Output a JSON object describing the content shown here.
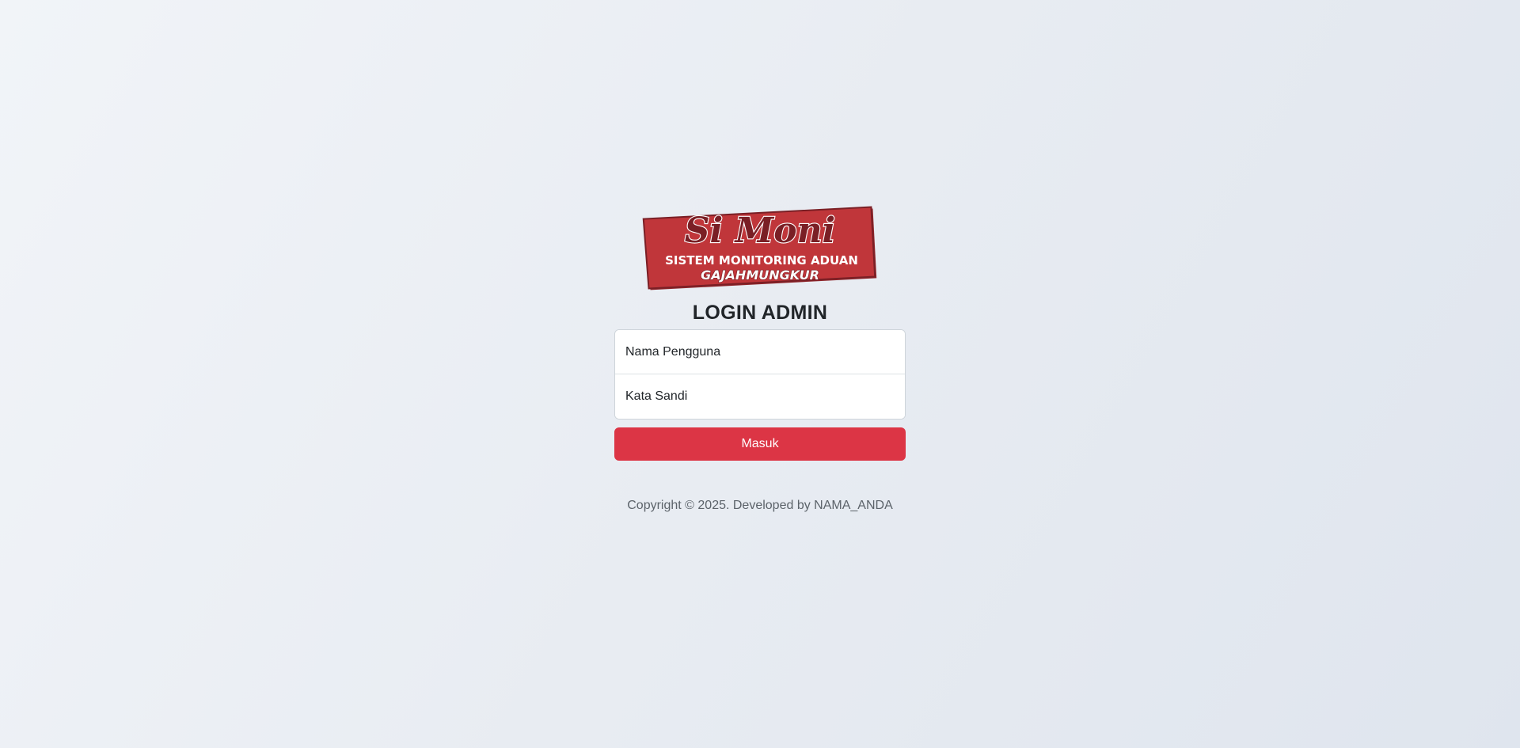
{
  "logo": {
    "line1": "Si Moni",
    "line2": "SISTEM MONITORING ADUAN",
    "line3": "GAJAHMUNGKUR",
    "colors": {
      "banner": "#c0363a",
      "banner_dark": "#8f262b",
      "script_text": "#7a1f25",
      "white_text": "#ffffff"
    }
  },
  "page": {
    "title": "LOGIN ADMIN"
  },
  "form": {
    "username_placeholder": "Nama Pengguna",
    "password_placeholder": "Kata Sandi",
    "submit_label": "Masuk"
  },
  "footer": {
    "copyright": "Copyright © 2025. Developed by NAMA_ANDA"
  },
  "colors": {
    "accent": "#dc3545",
    "background": "#e8ecf2"
  }
}
